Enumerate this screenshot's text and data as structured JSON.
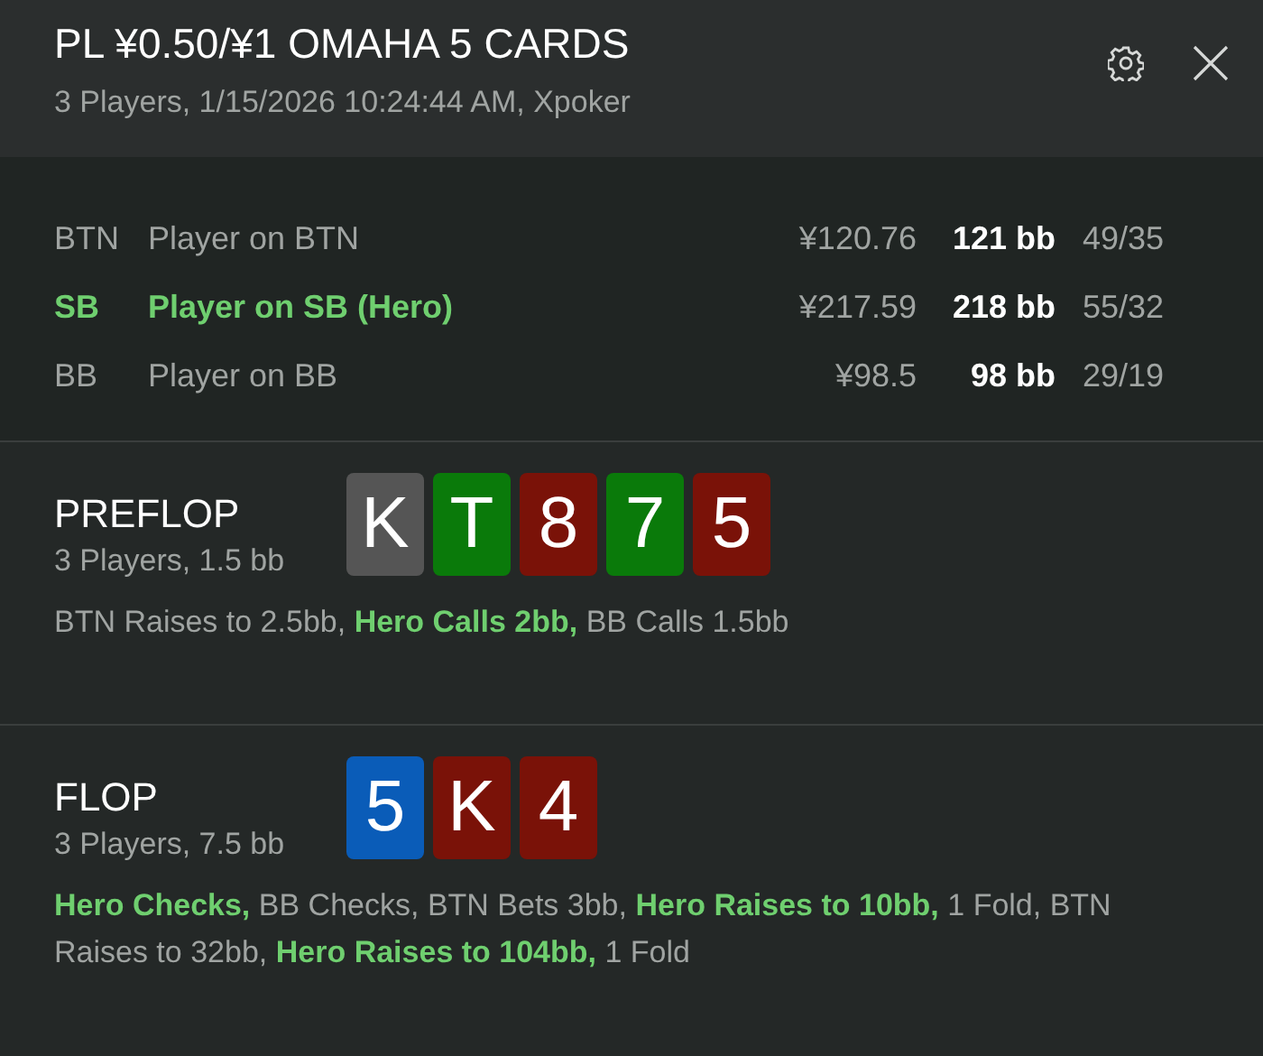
{
  "header": {
    "title": "PL ¥0.50/¥1 OMAHA 5 CARDS",
    "subtitle": "3 Players, 1/15/2026 10:24:44 AM, Xpoker"
  },
  "players": [
    {
      "position": "BTN",
      "name": "Player on BTN",
      "stack": "¥120.76",
      "stack_bb": "121 bb",
      "stats": "49/35",
      "hero": false
    },
    {
      "position": "SB",
      "name": "Player on SB (Hero)",
      "stack": "¥217.59",
      "stack_bb": "218 bb",
      "stats": "55/32",
      "hero": true
    },
    {
      "position": "BB",
      "name": "Player on BB",
      "stack": "¥98.5",
      "stack_bb": "98 bb",
      "stats": "29/19",
      "hero": false
    }
  ],
  "streets": [
    {
      "name": "PREFLOP",
      "summary": "3 Players, 1.5 bb",
      "cards": [
        {
          "rank": "K",
          "color": "#555555"
        },
        {
          "rank": "T",
          "color": "#0a7a0a"
        },
        {
          "rank": "8",
          "color": "#7a1208"
        },
        {
          "rank": "7",
          "color": "#0a7a0a"
        },
        {
          "rank": "5",
          "color": "#7a1208"
        }
      ],
      "actions": [
        {
          "text": "BTN Raises to 2.5bb,",
          "hero": false
        },
        {
          "text": "Hero Calls 2bb,",
          "hero": true
        },
        {
          "text": "BB Calls 1.5bb",
          "hero": false
        }
      ]
    },
    {
      "name": "FLOP",
      "summary": "3 Players, 7.5 bb",
      "cards": [
        {
          "rank": "5",
          "color": "#0a5cb8"
        },
        {
          "rank": "K",
          "color": "#7a1208"
        },
        {
          "rank": "4",
          "color": "#7a1208"
        }
      ],
      "actions": [
        {
          "text": "Hero Checks,",
          "hero": true
        },
        {
          "text": "BB Checks, BTN Bets 3bb,",
          "hero": false
        },
        {
          "text": "Hero Raises to 10bb,",
          "hero": true
        },
        {
          "text": "1 Fold, BTN",
          "hero": false
        },
        {
          "text": "Raises to 32bb,",
          "hero": false
        },
        {
          "text": "Hero Raises to 104bb,",
          "hero": true
        },
        {
          "text": "1 Fold",
          "hero": false
        }
      ]
    }
  ]
}
